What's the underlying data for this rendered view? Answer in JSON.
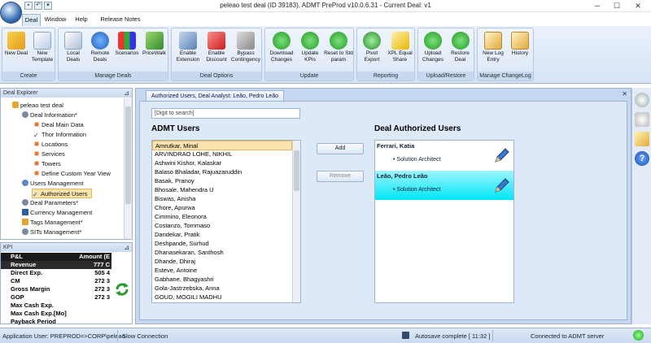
{
  "window": {
    "title": "peleao test deal (ID 39183), ADMT PreProd v10.0.6.31 - Current Deal: v1"
  },
  "tabs": [
    {
      "label": "Deal"
    },
    {
      "label": "Window"
    },
    {
      "label": "Help"
    },
    {
      "label": "Release Notes"
    }
  ],
  "ribbon": {
    "groups": [
      {
        "label": "Create",
        "buttons": [
          {
            "label": "New Deal"
          },
          {
            "label": "New Template"
          }
        ]
      },
      {
        "label": "Manage Deals",
        "buttons": [
          {
            "label": "Local Deals"
          },
          {
            "label": "Remote Deals"
          },
          {
            "label": "Scenarios"
          },
          {
            "label": "PriceWalk"
          }
        ]
      },
      {
        "label": "Deal Options",
        "buttons": [
          {
            "label": "Enable Extension"
          },
          {
            "label": "Enable Discount"
          },
          {
            "label": "Bypass Contingency"
          }
        ]
      },
      {
        "label": "Update",
        "buttons": [
          {
            "label": "Download Changes"
          },
          {
            "label": "Update KPIs"
          },
          {
            "label": "Reset to Std param"
          }
        ]
      },
      {
        "label": "Reporting",
        "buttons": [
          {
            "label": "Pivot Export"
          },
          {
            "label": "XPL Equal Share"
          }
        ]
      },
      {
        "label": "Upload/Restore",
        "buttons": [
          {
            "label": "Upload Changes"
          },
          {
            "label": "Restore Deal"
          }
        ]
      },
      {
        "label": "Manage ChangeLog",
        "buttons": [
          {
            "label": "New Log Entry"
          },
          {
            "label": "History"
          }
        ]
      }
    ]
  },
  "explorer": {
    "header": "Deal Explorer",
    "tree": [
      {
        "label": "peleao test deal"
      },
      {
        "label": "Deal Information*"
      },
      {
        "label": "Deal Main Data"
      },
      {
        "label": "Thor Information"
      },
      {
        "label": "Locations"
      },
      {
        "label": "Services"
      },
      {
        "label": "Towers"
      },
      {
        "label": "Define Custom Year View"
      },
      {
        "label": "Users Management"
      },
      {
        "label": "Authorized Users"
      },
      {
        "label": "Deal Parameters*"
      },
      {
        "label": "Currency Management"
      },
      {
        "label": "Tags Management*"
      },
      {
        "label": "SITs Management*"
      }
    ]
  },
  "kpi": {
    "header": "KPI",
    "columns": [
      "P&L",
      "Amount (E"
    ],
    "rows": [
      {
        "label": "Revenue",
        "value": "777 C"
      },
      {
        "label": "Direct Exp.",
        "value": "505 4"
      },
      {
        "label": "CM",
        "value": "272 3"
      },
      {
        "label": "Gross Margin",
        "value": "272 3"
      },
      {
        "label": "GOP",
        "value": "272 3"
      },
      {
        "label": "Max Cash Exp.",
        "value": ""
      },
      {
        "label": "Max Cash Exp.[Mo]",
        "value": ""
      },
      {
        "label": "Payback Period",
        "value": ""
      }
    ]
  },
  "document": {
    "tab_title": "Authorized Users, Deal Analyst: Leão, Pedro Leão",
    "search_placeholder": "[Digit to search]",
    "admt_users_title": "ADMT Users",
    "deal_users_title": "Deal Authorized Users",
    "add_label": "Add",
    "remove_label": "Remove",
    "admt_users": [
      "Amrutkar, Minal",
      "ARVINDRAO LOHE, NIKHIL",
      "Ashwini Kishor, Kalaskar",
      "Balaso Bhaladar, Rajuazaruddin",
      "Basak, Pranoy",
      "Bhosale, Mahendra U",
      "Biswas, Anisha",
      "Chore, Apurwa",
      "Cimmino, Eleonora",
      "Costanzo, Tommaso",
      "Dandekar, Pratik",
      "Deshpande, Surhud",
      "Dhanasekaran, Santhosh",
      "Dhande, Dhiraj",
      "Esteve, Antoine",
      "Gabhane, Bhagyashri",
      "Gola-Jastrzebska, Anna",
      "GOUD, MOGILI MADHU"
    ],
    "authorized_users": [
      {
        "name": "Ferrari, Katia",
        "role": "Solution Architect"
      },
      {
        "name": "Leão, Pedro Leão",
        "role": "Solution Architect"
      }
    ]
  },
  "status": {
    "app_user": "Application User: PREPROD=>CORP\\peleao",
    "connection": "Slow Connection",
    "autosave": "Autosave complete [ 11:32 ]",
    "server": "Connected to ADMT server"
  },
  "colors": {
    "accent": "#3a6fb0",
    "selected_row": "#fbe3ad",
    "selected_card": "#00e5f5",
    "status_ok": "#22bb22"
  }
}
